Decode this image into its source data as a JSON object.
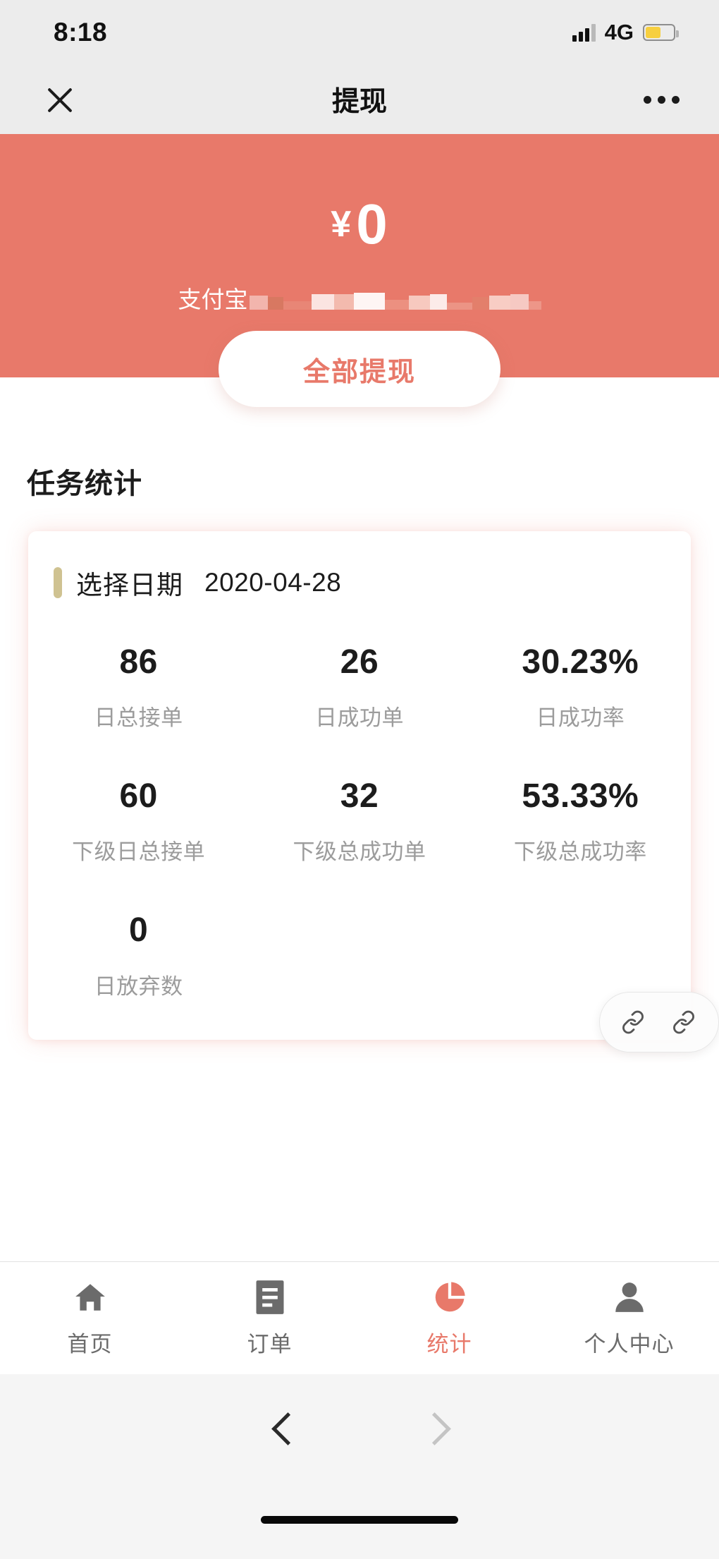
{
  "status_bar": {
    "time": "8:18",
    "network": "4G",
    "signal_icon": "signal-bars-icon",
    "battery_icon": "battery-icon",
    "battery_level": "55%"
  },
  "header": {
    "close_icon": "close-icon",
    "title": "提现",
    "more_icon": "more-horizontal-icon"
  },
  "banner": {
    "currency_symbol": "¥",
    "amount": "0",
    "account_label": "支付宝",
    "account_value_redacted": "████ ███ ██",
    "withdraw_button": "全部提现",
    "background_color": "#e8796a",
    "accent_color": "#e8796a"
  },
  "section": {
    "title": "任务统计"
  },
  "stats_card": {
    "date_picker": {
      "label": "选择日期",
      "value": "2020-04-28",
      "accent_color": "#cfc291"
    },
    "rows": [
      [
        {
          "value": "86",
          "label": "日总接单"
        },
        {
          "value": "26",
          "label": "日成功单"
        },
        {
          "value": "30.23%",
          "label": "日成功率"
        }
      ],
      [
        {
          "value": "60",
          "label": "下级日总接单"
        },
        {
          "value": "32",
          "label": "下级总成功单"
        },
        {
          "value": "53.33%",
          "label": "下级总成功率"
        }
      ],
      [
        {
          "value": "0",
          "label": "日放弃数"
        }
      ]
    ]
  },
  "float_widget": {
    "buttons": [
      {
        "icon": "link-icon"
      },
      {
        "icon": "link-icon"
      }
    ]
  },
  "tabbar": {
    "tabs": [
      {
        "label": "首页",
        "icon": "home-icon",
        "active": false
      },
      {
        "label": "订单",
        "icon": "document-list-icon",
        "active": false
      },
      {
        "label": "统计",
        "icon": "pie-chart-icon",
        "active": true
      },
      {
        "label": "个人中心",
        "icon": "person-icon",
        "active": false
      }
    ],
    "active_color": "#e8796a",
    "inactive_color": "#6b6b6b"
  },
  "browser_nav": {
    "back_icon": "chevron-left-icon",
    "forward_icon": "chevron-right-icon"
  },
  "home_indicator": {
    "icon": "home-indicator-bar"
  }
}
